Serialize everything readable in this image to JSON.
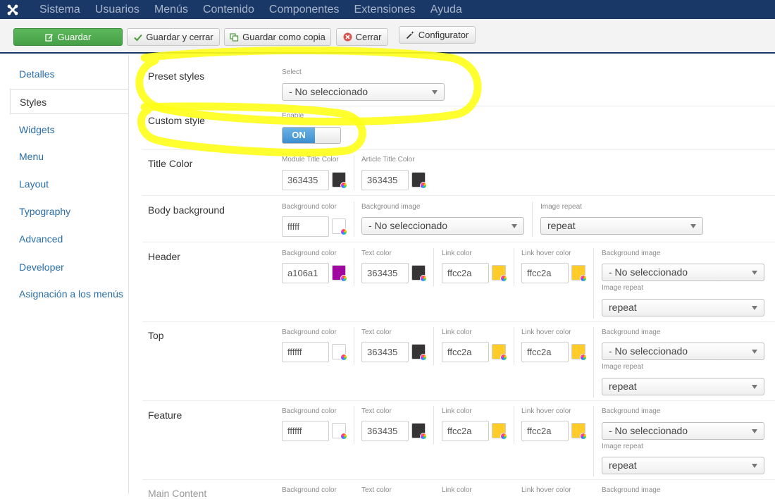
{
  "navbar": {
    "logo_icon": "joomla-icon",
    "items": [
      "Sistema",
      "Usuarios",
      "Menús",
      "Contenido",
      "Componentes",
      "Extensiones",
      "Ayuda"
    ]
  },
  "toolbar": {
    "save_label": "Guardar",
    "save_close_label": "Guardar y cerrar",
    "save_copy_label": "Guardar como copia",
    "close_label": "Cerrar",
    "configurator_label": "Configurator"
  },
  "sidebar": {
    "tabs": [
      "Detalles",
      "Styles",
      "Widgets",
      "Menu",
      "Layout",
      "Typography",
      "Advanced",
      "Developer",
      "Asignación a los menús"
    ],
    "active": "Styles"
  },
  "preset": {
    "label": "Preset styles",
    "field_label": "Select",
    "value": "- No seleccionado"
  },
  "custom": {
    "label": "Custom style",
    "field_label": "Enable",
    "toggle_value": "ON"
  },
  "title_color": {
    "label": "Title Color",
    "module_label": "Module Title Color",
    "module_value": "363435",
    "article_label": "Article Title Color",
    "article_value": "363435"
  },
  "body_bg": {
    "label": "Body background",
    "color_label": "Background color",
    "color_value": "fffff",
    "image_label": "Background image",
    "image_value": "- No seleccionado",
    "repeat_label": "Image repeat",
    "repeat_value": "repeat"
  },
  "field_labels": {
    "bg_color": "Background color",
    "text_color": "Text color",
    "link_color": "Link color",
    "link_hover": "Link hover color",
    "bg_image": "Background image",
    "img_repeat": "Image repeat"
  },
  "header": {
    "label": "Header",
    "bg_value": "a106a1",
    "text_value": "363435",
    "link_value": "ffcc2a",
    "hover_value": "ffcc2a",
    "image_value": "- No seleccionado",
    "repeat_value": "repeat"
  },
  "top": {
    "label": "Top",
    "bg_value": "ffffff",
    "text_value": "363435",
    "link_value": "ffcc2a",
    "hover_value": "ffcc2a",
    "image_value": "- No seleccionado",
    "repeat_value": "repeat"
  },
  "feature": {
    "label": "Feature",
    "bg_value": "ffffff",
    "text_value": "363435",
    "link_value": "ffcc2a",
    "hover_value": "ffcc2a",
    "image_value": "- No seleccionado",
    "repeat_value": "repeat"
  },
  "main_content": {
    "label": "Main Content"
  },
  "colors": {
    "navbar": "#1a3867",
    "save_button": "#5cb85c",
    "link": "#2a6ea8",
    "swatch_dark": "#363435",
    "swatch_purple": "#a106a1",
    "swatch_yellow": "#ffcc2a",
    "highlight": "#ffff1a"
  }
}
